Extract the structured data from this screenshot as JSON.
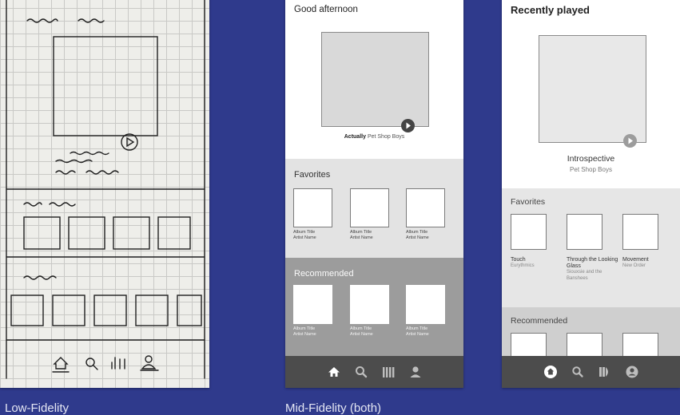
{
  "captions": {
    "low": "Low-Fidelity",
    "mid": "Mid-Fidelity (both)"
  },
  "mid1": {
    "greeting": "Good afternoon",
    "hero": {
      "title": "Actually",
      "artist": "Pet Shop Boys"
    },
    "favorites": {
      "title": "Favorites",
      "items": [
        {
          "title": "Album Title",
          "artist": "Artist Name"
        },
        {
          "title": "Album Title",
          "artist": "Artist Name"
        },
        {
          "title": "Album Title",
          "artist": "Artist Name"
        }
      ]
    },
    "recommended": {
      "title": "Recommended",
      "items": [
        {
          "title": "Album Title",
          "artist": "Artist Name"
        },
        {
          "title": "Album Title",
          "artist": "Artist Name"
        },
        {
          "title": "Album Title",
          "artist": "Artist Name"
        }
      ]
    },
    "tabs": [
      "home-icon",
      "search-icon",
      "library-icon",
      "profile-icon"
    ]
  },
  "mid2": {
    "heading": "Recently played",
    "hero": {
      "title": "Introspective",
      "artist": "Pet Shop Boys"
    },
    "favorites": {
      "title": "Favorites",
      "items": [
        {
          "title": "Touch",
          "artist": "Eurythmics"
        },
        {
          "title": "Through the Looking Glass",
          "artist": "Siouxsie and the Banshees"
        },
        {
          "title": "Movement",
          "artist": "New Order"
        }
      ]
    },
    "recommended": {
      "title": "Recommended"
    },
    "tabs": [
      "home-icon",
      "search-icon",
      "library-icon",
      "profile-icon"
    ]
  },
  "colors": {
    "background": "#2f3a8c",
    "tabbar": "#4c4c4c"
  }
}
